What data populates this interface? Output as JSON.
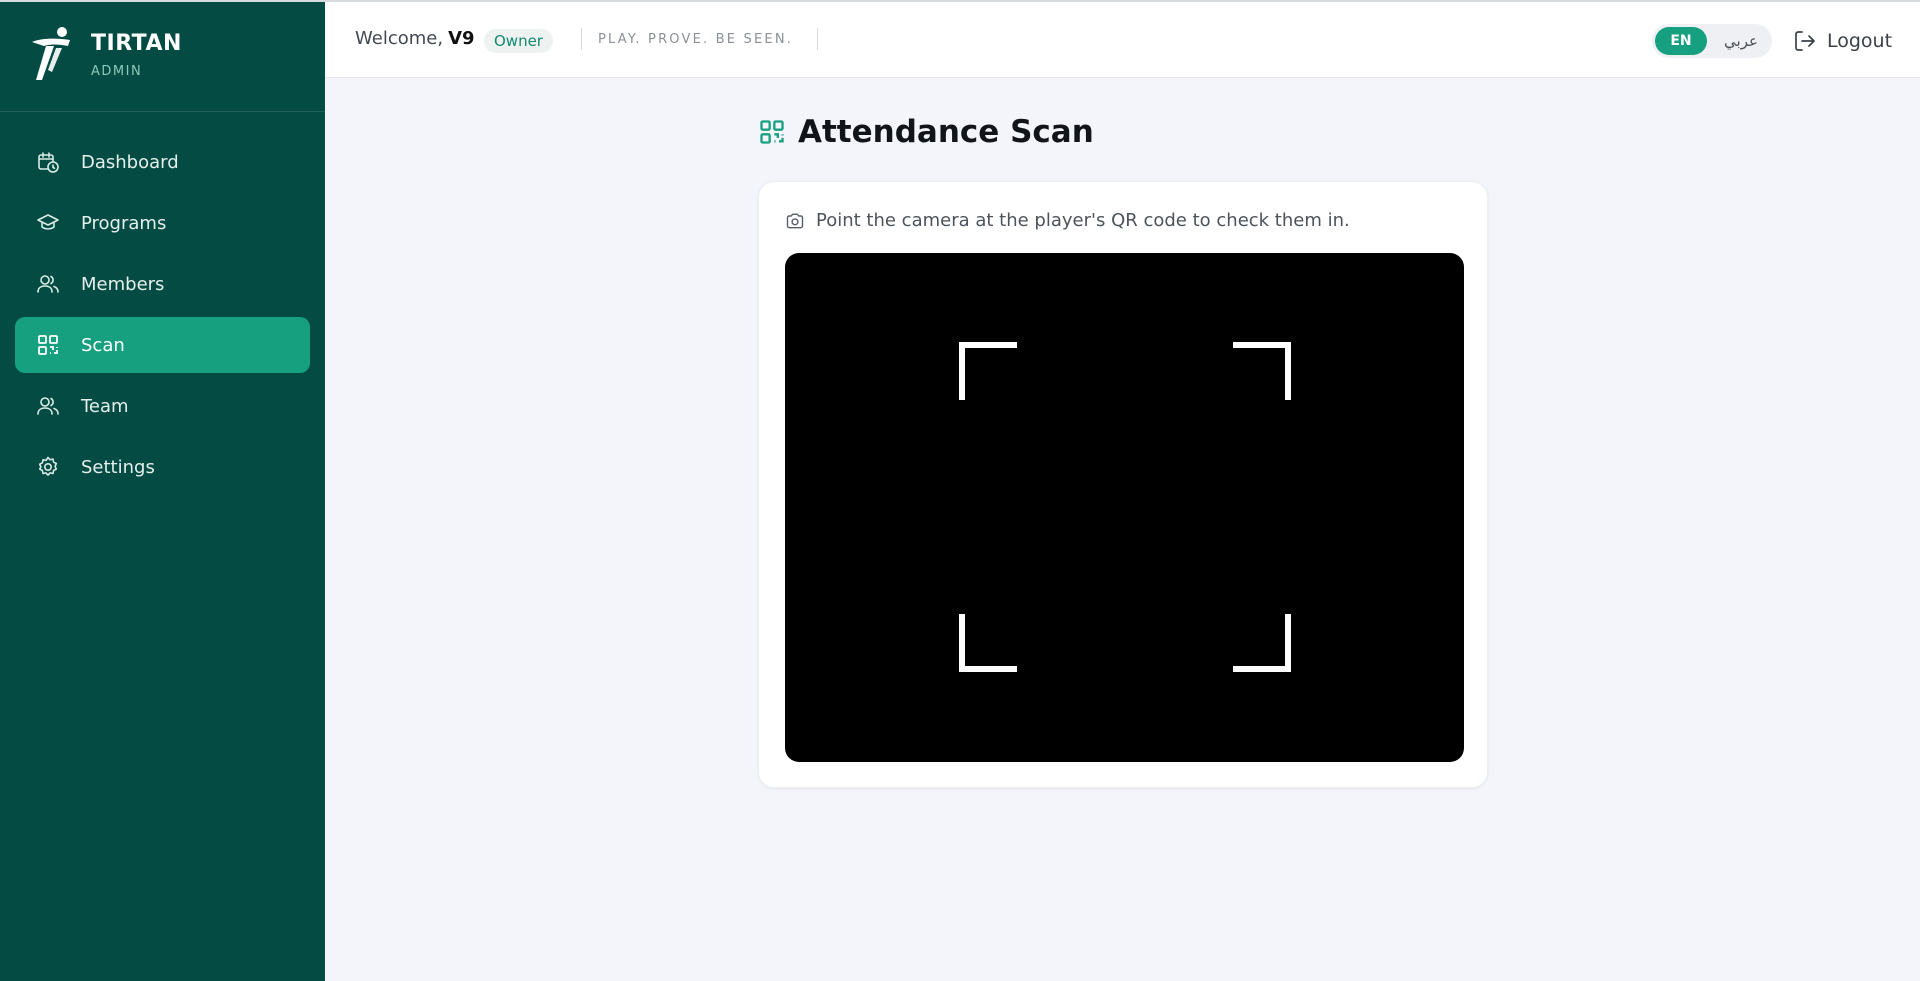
{
  "app": {
    "brand_name": "TIRTAN",
    "brand_sub": "ADMIN",
    "accent_color": "#17a080",
    "sidebar_color": "#044c43"
  },
  "sidebar": {
    "items": [
      {
        "label": "Dashboard",
        "icon": "calendar-clock-icon",
        "active": false
      },
      {
        "label": "Programs",
        "icon": "graduation-cap-icon",
        "active": false
      },
      {
        "label": "Members",
        "icon": "users-icon",
        "active": false
      },
      {
        "label": "Scan",
        "icon": "qr-code-icon",
        "active": true
      },
      {
        "label": "Team",
        "icon": "users-icon",
        "active": false
      },
      {
        "label": "Settings",
        "icon": "gear-icon",
        "active": false
      }
    ]
  },
  "header": {
    "welcome_prefix": "Welcome,",
    "user_name": "V9",
    "role": "Owner",
    "tagline": "PLAY. PROVE. BE SEEN.",
    "lang_en": "EN",
    "lang_ar": "عربي",
    "logout_label": "Logout"
  },
  "main": {
    "page_title": "Attendance Scan",
    "hint": "Point the camera at the player's QR code to check them in."
  }
}
